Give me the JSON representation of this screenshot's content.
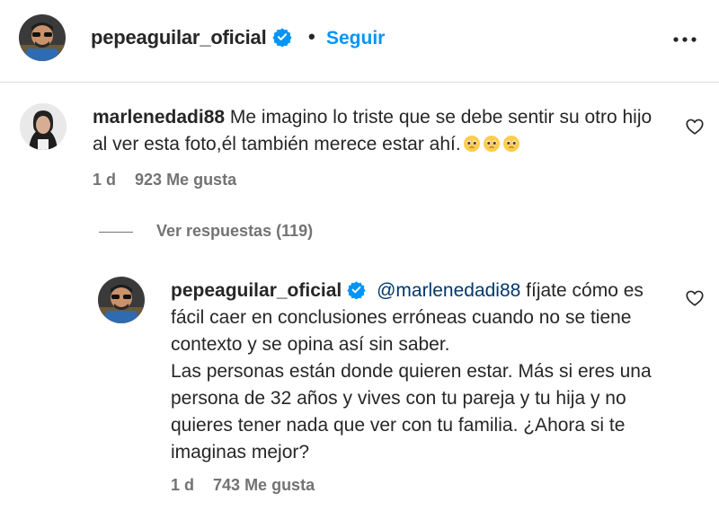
{
  "post_header": {
    "username": "pepeaguilar_oficial",
    "verified_icon": "verified-badge-icon",
    "separator": "•",
    "follow_label": "Seguir",
    "more_icon": "more-options-icon"
  },
  "comment": {
    "username": "marlenedadi88",
    "text": "Me imagino lo triste que se debe sentir su otro hijo al ver esta foto,él también merece estar ahí.",
    "emojis": [
      "pleading-face-emoji",
      "pleading-face-emoji",
      "pleading-face-emoji"
    ],
    "time": "1 d",
    "likes": "923 Me gusta",
    "like_icon": "heart-icon"
  },
  "replies_toggle": {
    "label": "Ver respuestas (119)"
  },
  "reply": {
    "username": "pepeaguilar_oficial",
    "mention": "@marlenedadi88",
    "text": "fíjate cómo es fácil caer en conclusiones erróneas cuando no se tiene contexto y se opina así sin saber.",
    "text2": "Las personas están donde quieren estar. Más si eres una persona de 32 años y vives con tu pareja y tu hija y no quieres tener nada que ver con tu familia. ¿Ahora si te imaginas mejor?",
    "time": "1 d",
    "likes": "743 Me gusta",
    "like_icon": "heart-icon"
  },
  "colors": {
    "link_blue": "#0095f6",
    "mention_blue": "#00376b",
    "text": "#262626",
    "secondary": "#737373",
    "divider": "#dbdbdb"
  }
}
